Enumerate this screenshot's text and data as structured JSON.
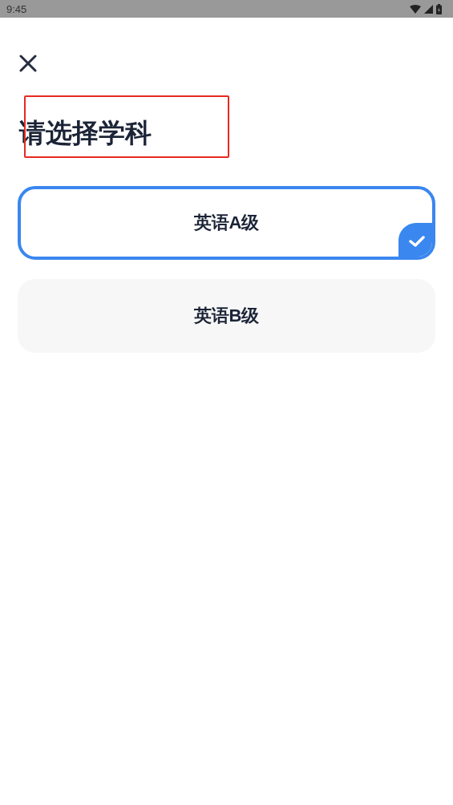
{
  "status_bar": {
    "time": "9:45"
  },
  "title": "请选择学科",
  "options": [
    {
      "label": "英语A级",
      "selected": true
    },
    {
      "label": "英语B级",
      "selected": false
    }
  ]
}
